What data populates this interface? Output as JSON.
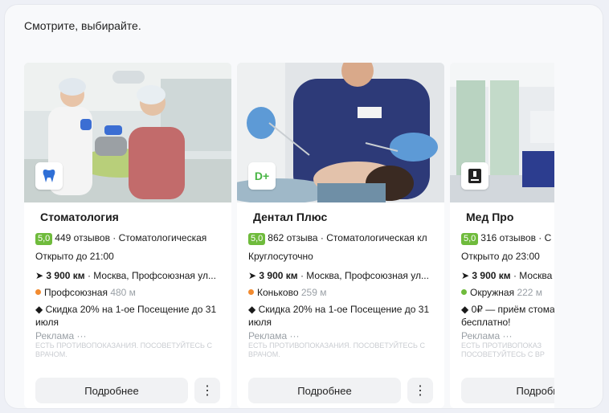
{
  "heading": "Смотрите, выбирайте.",
  "cards": [
    {
      "logo": "tooth-icon",
      "name": "Стоматология",
      "rating": "5,0",
      "reviews_category": "449 отзывов · Стоматологическая",
      "hours": "Открыто до 21:00",
      "distance": "3 900 км",
      "address": " · Москва, Профсоюзная ул...",
      "metro": "Профсоюзная",
      "metro_distance": "480 м",
      "metro_color": "#f28b30",
      "promo": "Скидка 20% на 1-ое Посещение до 31 июля",
      "ad_label": "Реклама ···",
      "warning": "Есть противопоказания. Посоветуйтесь с врачом.",
      "button": "Подробнее",
      "more": "⋮"
    },
    {
      "logo": "D+",
      "name": "Дентал Плюс",
      "rating": "5,0",
      "reviews_category": "862 отзыва · Стоматологическая кл",
      "hours": "Круглосуточно",
      "distance": "3 900 км",
      "address": " · Москва, Профсоюзная ул...",
      "metro": "Коньково",
      "metro_distance": "259 м",
      "metro_color": "#f28b30",
      "promo": "Скидка 20% на 1-ое Посещение до 31 июля",
      "ad_label": "Реклама ···",
      "warning": "Есть противопоказания. Посоветуйтесь с врачом.",
      "button": "Подробнее",
      "more": "⋮"
    },
    {
      "logo": "microscope-icon",
      "name": "Мед Про",
      "rating": "5,0",
      "reviews_category": "316 отзывов · С",
      "hours": "Открыто до 23:00",
      "distance": "3 900 км",
      "address": " · Москва",
      "metro": "Окружная",
      "metro_distance": "222 м",
      "metro_color": "#6fbb3c",
      "promo": "0₽ — приём стома бесплатно!",
      "ad_label": "Реклама ···",
      "warning": "Есть противопоказ посоветуйтесь с вр",
      "button": "Подробн",
      "more": "⋮"
    }
  ]
}
